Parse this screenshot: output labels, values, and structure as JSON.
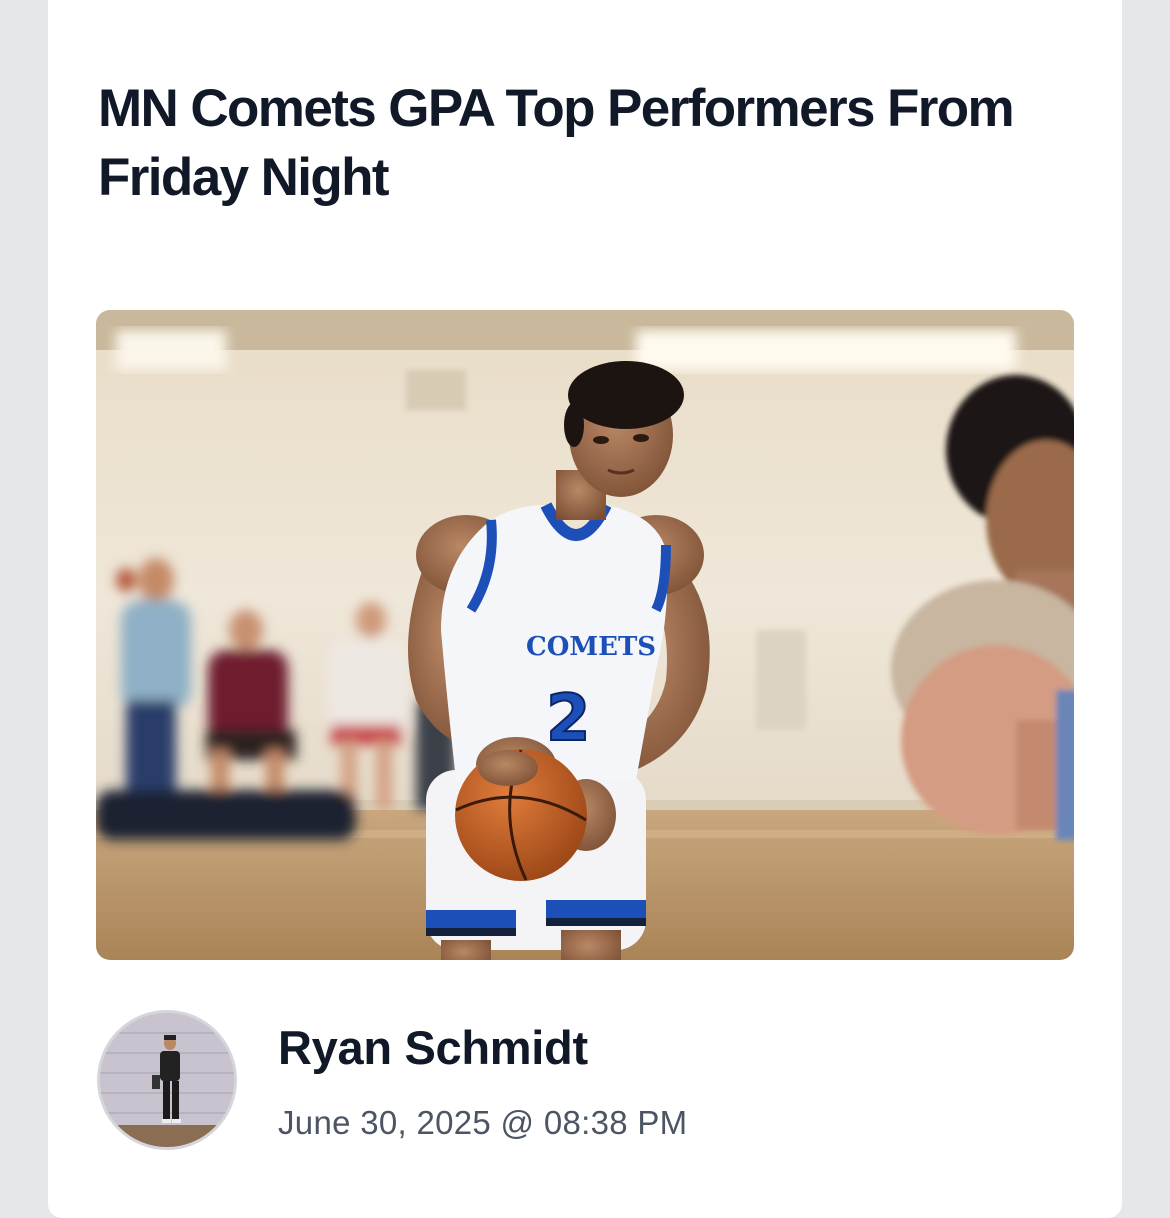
{
  "article": {
    "title": "MN Comets GPA Top Performers From Friday Night",
    "image_description": "basketball-player-free-throw-photo",
    "jersey": {
      "team": "COMETS",
      "number": "2"
    }
  },
  "author": {
    "name": "Ryan Schmidt",
    "date": "June 30, 2025 @ 08:38 PM"
  },
  "colors": {
    "page_bg": "#e6e7ea",
    "card_bg": "#ffffff",
    "title": "#111827",
    "meta": "#4b5563",
    "jersey_blue": "#1d4fb8"
  }
}
